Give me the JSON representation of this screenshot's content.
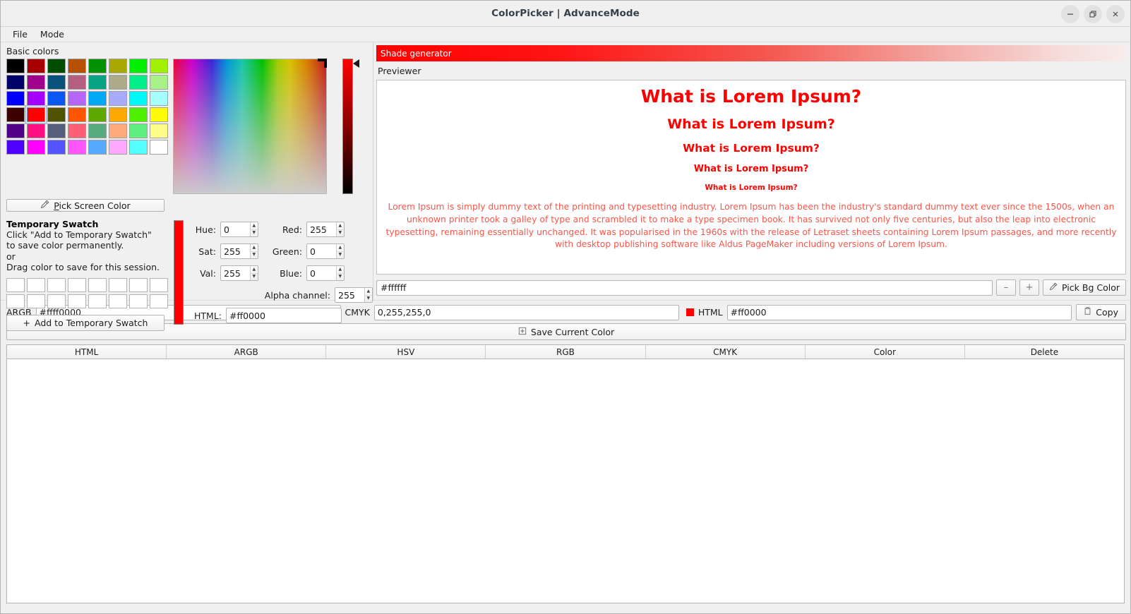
{
  "window": {
    "title": "ColorPicker | AdvanceMode",
    "controls": [
      {
        "name": "minimize-button",
        "glyph": "minimize-icon"
      },
      {
        "name": "restore-button",
        "glyph": "restore-icon"
      },
      {
        "name": "close-button",
        "glyph": "close-icon"
      }
    ]
  },
  "menubar": {
    "items": [
      {
        "label": "File"
      },
      {
        "label": "Mode"
      }
    ]
  },
  "basic_colors": {
    "label": "Basic colors",
    "selected_index": 25,
    "swatches": [
      "#000000",
      "#a80000",
      "#004c00",
      "#b55100",
      "#029100",
      "#a8a800",
      "#00f000",
      "#a0f000",
      "#000069",
      "#a1008c",
      "#08527c",
      "#b55f80",
      "#07a484",
      "#acaa88",
      "#00ef88",
      "#a8f088",
      "#0000fa",
      "#a500fa",
      "#0b57f6",
      "#b566f6",
      "#00a8f8",
      "#a8aafa",
      "#00f8f8",
      "#a6fdfd",
      "#3c0000",
      "#ff0000",
      "#4f5400",
      "#ff5500",
      "#60a800",
      "#ffa800",
      "#4ef000",
      "#fdfd00",
      "#520089",
      "#ff0f84",
      "#575d7d",
      "#ff5f75",
      "#56ab7f",
      "#ffaa7c",
      "#60f07f",
      "#fdfd8a",
      "#5100ff",
      "#ff00ff",
      "#5353ff",
      "#ff55ff",
      "#55aaff",
      "#ffaaff",
      "#55ffff",
      "#ffffff"
    ]
  },
  "picker": {
    "pick_screen_color_label": "Pick Screen Color",
    "pick_screen_color_accel": "P",
    "eyedropper_icon": "eyedropper-icon"
  },
  "temporary_swatch": {
    "title": "Temporary Swatch",
    "line1": "Click \"Add to Temporary Swatch\"",
    "line2": "to save color permanently.",
    "line3": "or",
    "line4": "Drag color to save for this session.",
    "slot_count": 16,
    "add_button_label": "Add to Temporary Swatch",
    "add_button_icon": "plus-icon"
  },
  "current_color": {
    "hex": "#ff0000"
  },
  "fields": {
    "hue": {
      "label": "Hue:",
      "value": "0"
    },
    "sat": {
      "label": "Sat:",
      "value": "255"
    },
    "val": {
      "label": "Val:",
      "value": "255"
    },
    "red": {
      "label": "Red:",
      "value": "255"
    },
    "green": {
      "label": "Green:",
      "value": "0"
    },
    "blue": {
      "label": "Blue:",
      "value": "0"
    },
    "alpha": {
      "label": "Alpha channel:",
      "value": "255"
    },
    "html": {
      "label": "HTML:",
      "value": "#ff0000"
    }
  },
  "shade_generator": {
    "label": "Shade generator",
    "gradient_from": "#ff0000",
    "gradient_to": "#f7eceb"
  },
  "previewer": {
    "label": "Previewer",
    "heading_text": "What is Lorem Ipsum?",
    "headings": [
      {
        "level": "h1",
        "text": "What is Lorem Ipsum?"
      },
      {
        "level": "h2",
        "text": "What is Lorem Ipsum?"
      },
      {
        "level": "h3",
        "text": "What is Lorem Ipsum?"
      },
      {
        "level": "h4",
        "text": "What is Lorem Ipsum?"
      },
      {
        "level": "h5",
        "text": "What is Lorem Ipsum?"
      }
    ],
    "paragraph": "Lorem Ipsum is simply dummy text of the printing and typesetting industry. Lorem Ipsum has been the industry's standard dummy text ever since the 1500s, when an unknown printer took a galley of type and scrambled it to make a type specimen book. It has survived not only five centuries, but also the leap into electronic typesetting, remaining essentially unchanged. It was popularised in the 1960s with the release of Letraset sheets containing Lorem Ipsum passages, and more recently with desktop publishing software like Aldus PageMaker including versions of Lorem Ipsum.",
    "text_color": "#ff0000",
    "paragraph_color": "#f9564a",
    "background_color": "#ffffff"
  },
  "background": {
    "value": "#ffffff",
    "decrease_label": "–",
    "increase_label": "+",
    "pick_bg_label": "Pick Bg Color",
    "pick_bg_icon": "eyedropper-icon"
  },
  "codes": {
    "argb_label": "ARGB",
    "argb_value": "#ffff0000",
    "cmyk_label": "CMYK",
    "cmyk_value": "0,255,255,0",
    "html_label": "HTML",
    "html_value": "#ff0000",
    "chip_color": "#ff0000",
    "copy_label": "Copy",
    "copy_icon": "clipboard-icon"
  },
  "save_bar": {
    "label": "Save Current Color",
    "icon": "save-plus-icon"
  },
  "table": {
    "columns": [
      "HTML",
      "ARGB",
      "HSV",
      "RGB",
      "CMYK",
      "Color",
      "Delete"
    ],
    "rows": []
  }
}
